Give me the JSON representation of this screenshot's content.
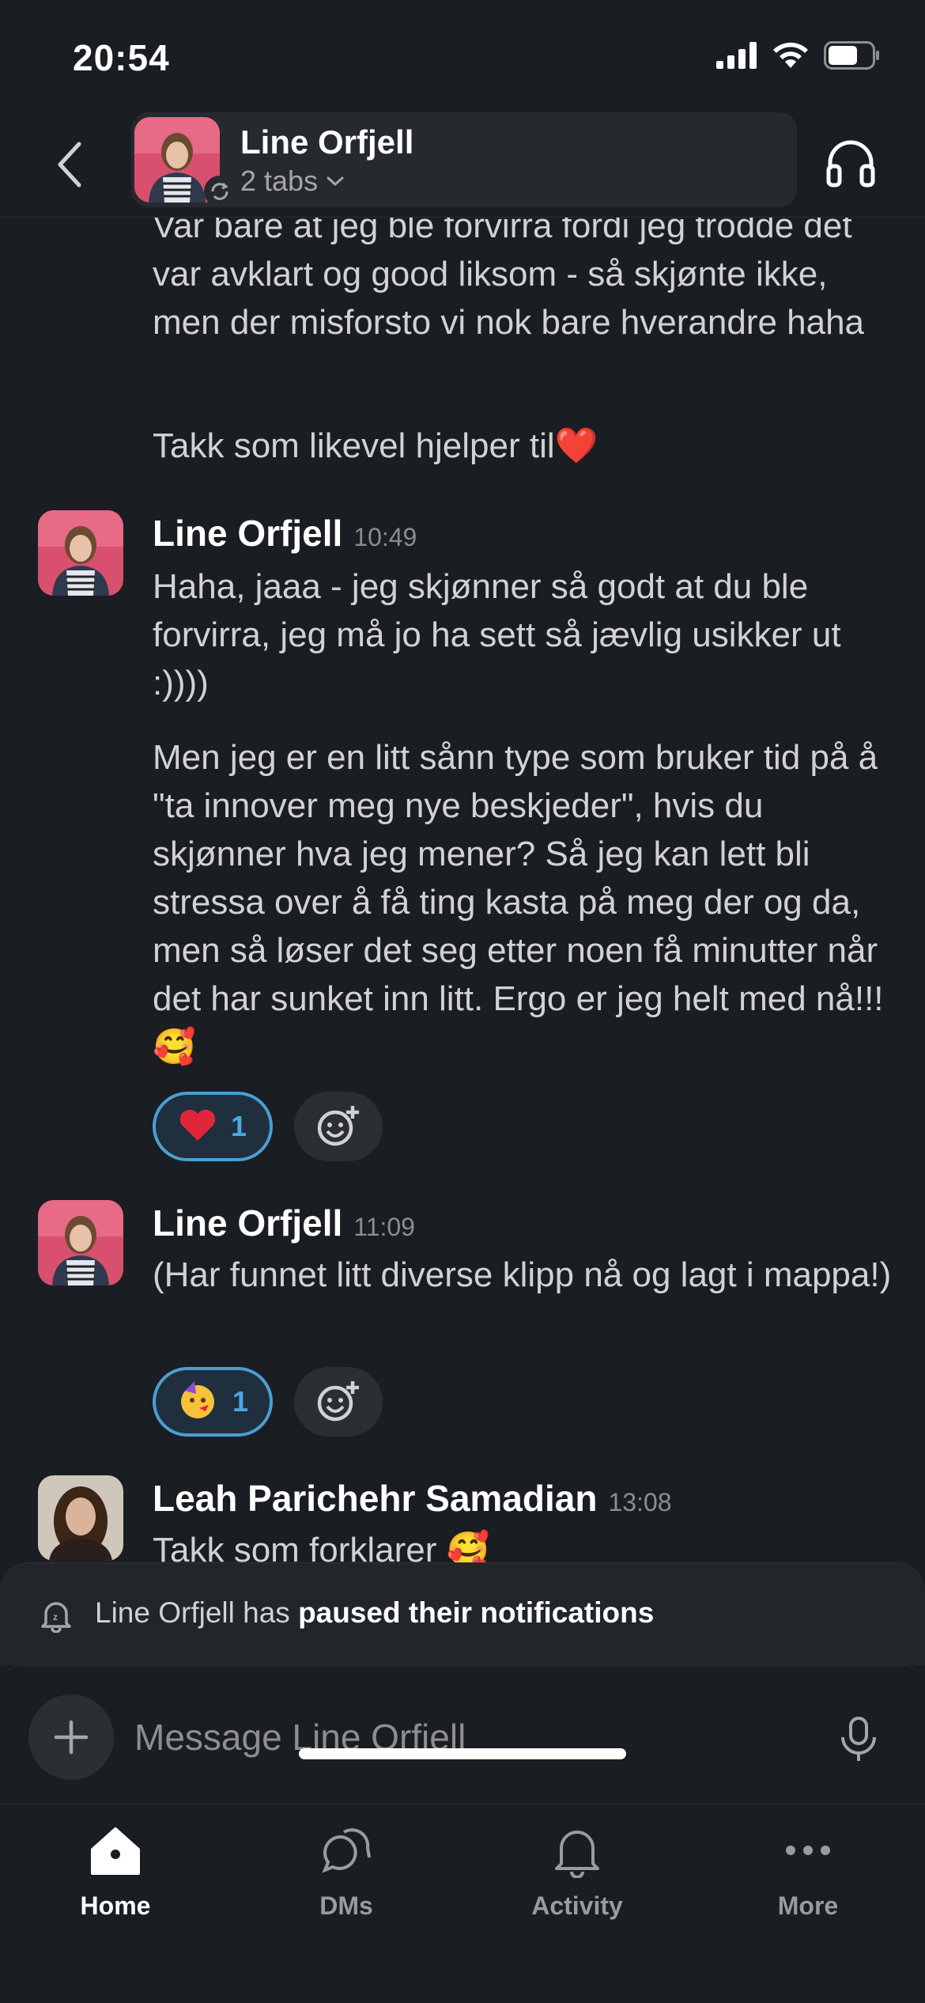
{
  "status_bar": {
    "time": "20:54",
    "icons": [
      "cellular-signal-icon",
      "wifi-icon",
      "battery-icon"
    ]
  },
  "header": {
    "back_icon": "chevron-left-icon",
    "channel_name": "Line Orfjell",
    "subtitle": "2 tabs",
    "subtitle_icon": "chevron-down-icon",
    "right_icon": "headphones-icon"
  },
  "messages": {
    "continued": {
      "paragraph_1": "Var bare at jeg ble forvirra fordi jeg trodde det var avklart og good liksom - så skjønte ikke, men der misforsto vi nok bare hverandre haha",
      "paragraph_2": "Takk som likevel hjelper til❤️"
    },
    "msg_1": {
      "author": "Line Orfjell",
      "time": "10:49",
      "paragraph_1": "Haha, jaaa - jeg skjønner så godt at du ble forvirra, jeg må jo ha sett så jævlig usikker ut :))))",
      "paragraph_2": "Men jeg er en litt sånn type som bruker tid på å \"ta innover meg nye beskjeder\", hvis du skjønner hva jeg mener? Så jeg kan lett bli stressa over å få ting kasta på meg der og da, men så løser det seg etter noen få minutter når det har sunket inn litt. Ergo er jeg helt med nå!!! 🥰",
      "reaction_emoji": "❤️",
      "reaction_count": "1"
    },
    "msg_2": {
      "author": "Line Orfjell",
      "time": "11:09",
      "text": "(Har funnet litt diverse klipp nå og lagt i mappa!)",
      "reaction_emoji": "🥳",
      "reaction_count": "1"
    },
    "msg_3": {
      "author": "Leah Parichehr Samadian",
      "time": "13:08",
      "text": "Takk som forklarer 🥰"
    }
  },
  "paused_banner": {
    "prefix": "Line Orfjell has ",
    "bold": "paused their notifications",
    "icon": "bell-snooze-icon"
  },
  "composer": {
    "placeholder": "Message Line Orfjell",
    "left_icon": "plus-icon",
    "right_icon": "microphone-icon"
  },
  "tabbar": {
    "tabs": [
      {
        "label": "Home",
        "icon": "home-icon",
        "active": true
      },
      {
        "label": "DMs",
        "icon": "dms-icon",
        "active": false
      },
      {
        "label": "Activity",
        "icon": "bell-icon",
        "active": false
      },
      {
        "label": "More",
        "icon": "more-icon",
        "active": false
      }
    ]
  },
  "colors": {
    "background": "#1a1d21",
    "text": "#d1d2d3",
    "accent": "#4a9ed3"
  }
}
